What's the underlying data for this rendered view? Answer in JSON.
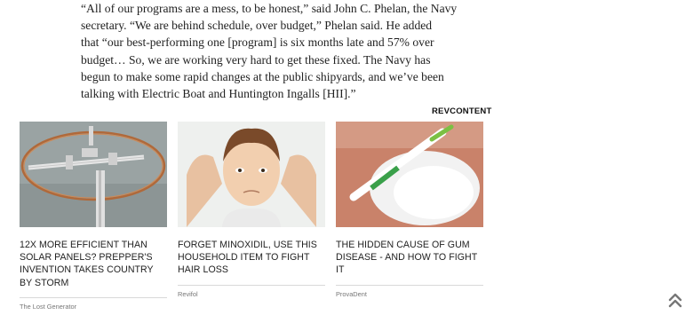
{
  "article": {
    "lines": [
      "“All of our programs are a mess, to be honest,” said John C. Phelan, the Navy",
      "secretary. “We are behind schedule, over budget,” Phelan said. He added",
      "that “our best-performing one [program] is six months late and 57% over",
      "budget… So, we are working very hard to get these fixed. The Navy has",
      "begun to make some rapid changes at the public shipyards, and we’ve been",
      "talking with Electric Boat and Huntington Ingalls [HII].”"
    ]
  },
  "sponsored": {
    "brand": "REVCONTENT",
    "cards": [
      {
        "headline": "12X MORE EFFICIENT THAN SOLAR PANELS? PREPPER'S INVENTION TAKES COUNTRY BY STORM",
        "source": "The Lost Generator",
        "image": "copper-ring-antenna-device"
      },
      {
        "headline": "FORGET MINOXIDIL, USE THIS HOUSEHOLD ITEM TO FIGHT HAIR LOSS",
        "source": "Revifol",
        "image": "illustrated-man-holding-head"
      },
      {
        "headline": "THE HIDDEN CAUSE OF GUM DISEASE - AND HOW TO FIGHT IT",
        "source": "ProvaDent",
        "image": "toothbrush-in-baking-soda"
      }
    ]
  },
  "scroll_top_icon": "double-chevron-up-icon",
  "colors": {
    "text": "#222222",
    "muted": "#777777",
    "rule": "#d9d9d9"
  }
}
